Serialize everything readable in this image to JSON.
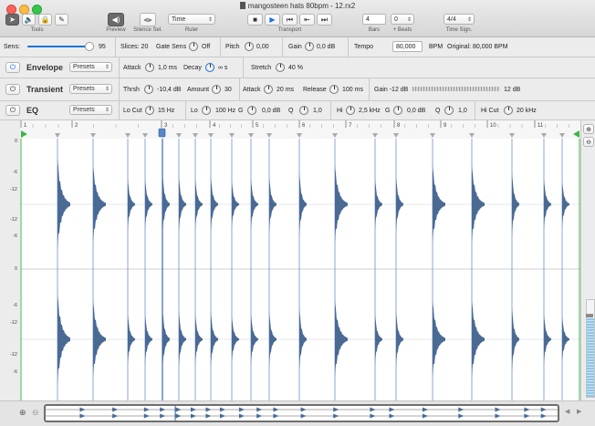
{
  "window": {
    "title": "mangosteen hats 80bpm - 12.rx2",
    "file_icon": "document-icon"
  },
  "toolbar": {
    "tools_label": "Tools",
    "preview_label": "Preview",
    "silence_sel_label": "Silence Sel.",
    "ruler_label": "Ruler",
    "ruler_value": "Time",
    "transport_label": "Transport",
    "bars_label": "Bars",
    "bars_value": "4",
    "beats_label": "+ Beats",
    "beats_value": "0",
    "timesig_label": "Time Sign.",
    "timesig_value": "4/4"
  },
  "controls": {
    "sens_label": "Sens:",
    "sens_value": "95",
    "sens_level": 0.95,
    "slices_label": "Slices: 20",
    "gate_label": "Gate Sens",
    "gate_value": "Off",
    "pitch_label": "Pitch",
    "pitch_value": "0,00",
    "gain_label": "Gain",
    "gain_value": "0,0 dB",
    "tempo_label": "Tempo",
    "tempo_value": "80,000",
    "bpm_label": "BPM",
    "original_label": "Original: 80,000 BPM"
  },
  "envelope": {
    "title": "Envelope",
    "presets": "Presets",
    "attack_label": "Attack",
    "attack_value": "1,0 ms",
    "decay_label": "Decay",
    "decay_value": "∞ s",
    "stretch_label": "Stretch",
    "stretch_value": "40 %"
  },
  "transient": {
    "title": "Transient",
    "presets": "Presets",
    "thrsh_label": "Thrsh",
    "thrsh_value": "-10,4 dB",
    "amount_label": "Amount",
    "amount_value": "30",
    "attack_label": "Attack",
    "attack_value": "20 ms",
    "release_label": "Release",
    "release_value": "100 ms",
    "gain_label": "Gain -12 dB",
    "gain_max": "12 dB"
  },
  "eq": {
    "title": "EQ",
    "presets": "Presets",
    "locut_label": "Lo Cut",
    "locut_value": "15 Hz",
    "lo_label": "Lo",
    "lo_freq": "100 Hz",
    "lo_g_label": "G",
    "lo_gain": "0,0 dB",
    "lo_q_label": "Q",
    "lo_q": "1,0",
    "hi_label": "Hi",
    "hi_freq": "2,5 kHz",
    "hi_g_label": "G",
    "hi_gain": "0,0 dB",
    "hi_q_label": "Q",
    "hi_q": "1,0",
    "hicut_label": "Hi Cut",
    "hicut_value": "20 kHz"
  },
  "ruler": {
    "bars": [
      "1",
      "2",
      "3",
      "4",
      "5",
      "6",
      "7",
      "8",
      "9",
      "10",
      "11"
    ]
  },
  "scale": {
    "labels": [
      "0",
      "-6",
      "-12",
      "-12",
      "-6",
      "0",
      "-6",
      "-12",
      "-12",
      "-6"
    ]
  },
  "colors": {
    "waveform": "#4a6a94",
    "slice_line": "#6f8fd6",
    "accent": "#1a73d9",
    "start_marker": "#3bb54a"
  }
}
